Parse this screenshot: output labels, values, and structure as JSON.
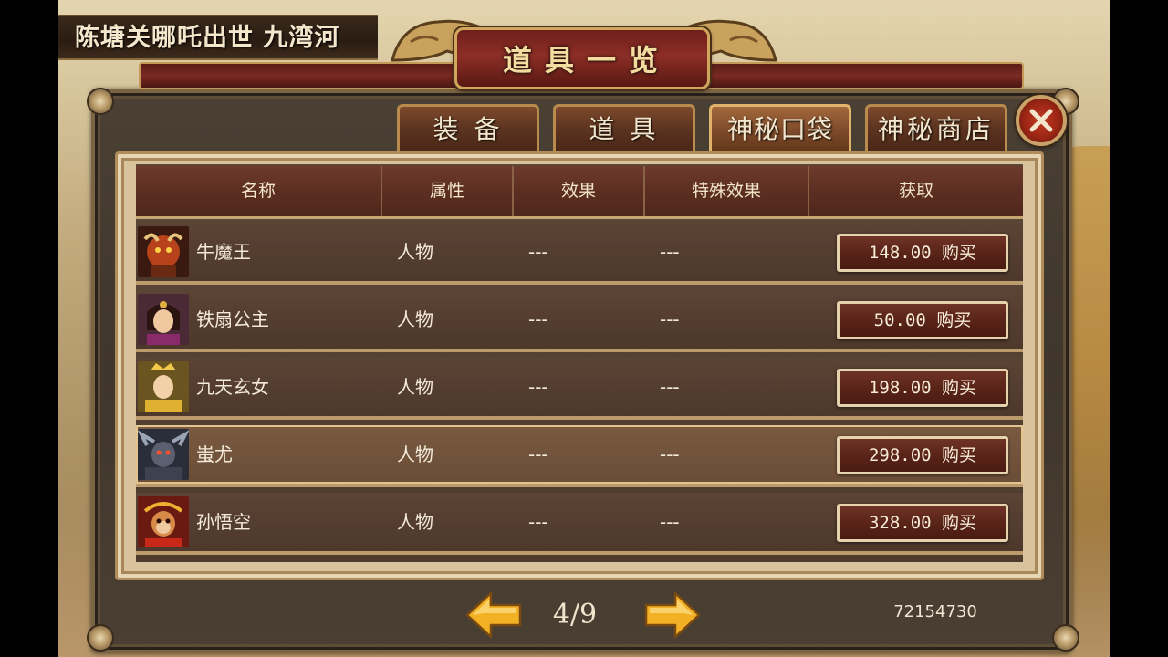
{
  "scene": {
    "title": "陈塘关哪吒出世 九湾河"
  },
  "window": {
    "title": "道具一览"
  },
  "tabs": [
    {
      "label": "装 备",
      "active": false
    },
    {
      "label": "道 具",
      "active": false
    },
    {
      "label": "神秘口袋",
      "active": true
    },
    {
      "label": "神秘商店",
      "active": false
    }
  ],
  "table": {
    "headers": [
      "名称",
      "属性",
      "效果",
      "特殊效果",
      "获取"
    ],
    "rows": [
      {
        "name": "牛魔王",
        "attribute": "人物",
        "effect": "---",
        "special": "---",
        "price": "148.00",
        "buy": "购买",
        "avatar": "bull-demon-king-portrait",
        "highlight": false
      },
      {
        "name": "铁扇公主",
        "attribute": "人物",
        "effect": "---",
        "special": "---",
        "price": "50.00",
        "buy": "购买",
        "avatar": "iron-fan-princess-portrait",
        "highlight": false
      },
      {
        "name": "九天玄女",
        "attribute": "人物",
        "effect": "---",
        "special": "---",
        "price": "198.00",
        "buy": "购买",
        "avatar": "nine-heavens-maiden-portrait",
        "highlight": false
      },
      {
        "name": "蚩尤",
        "attribute": "人物",
        "effect": "---",
        "special": "---",
        "price": "298.00",
        "buy": "购买",
        "avatar": "chiyou-portrait",
        "highlight": true
      },
      {
        "name": "孙悟空",
        "attribute": "人物",
        "effect": "---",
        "special": "---",
        "price": "328.00",
        "buy": "购买",
        "avatar": "sun-wukong-portrait",
        "highlight": false
      }
    ]
  },
  "pagination": {
    "current": 4,
    "total": 9,
    "label": "4/9"
  },
  "player_id": "72154730",
  "colors": {
    "frame": "#4a4034",
    "header_red": "#6e3a2c",
    "gold_trim": "#c49a58",
    "buy_button": "#5a2419",
    "arrow_gold": "#f2b024"
  }
}
